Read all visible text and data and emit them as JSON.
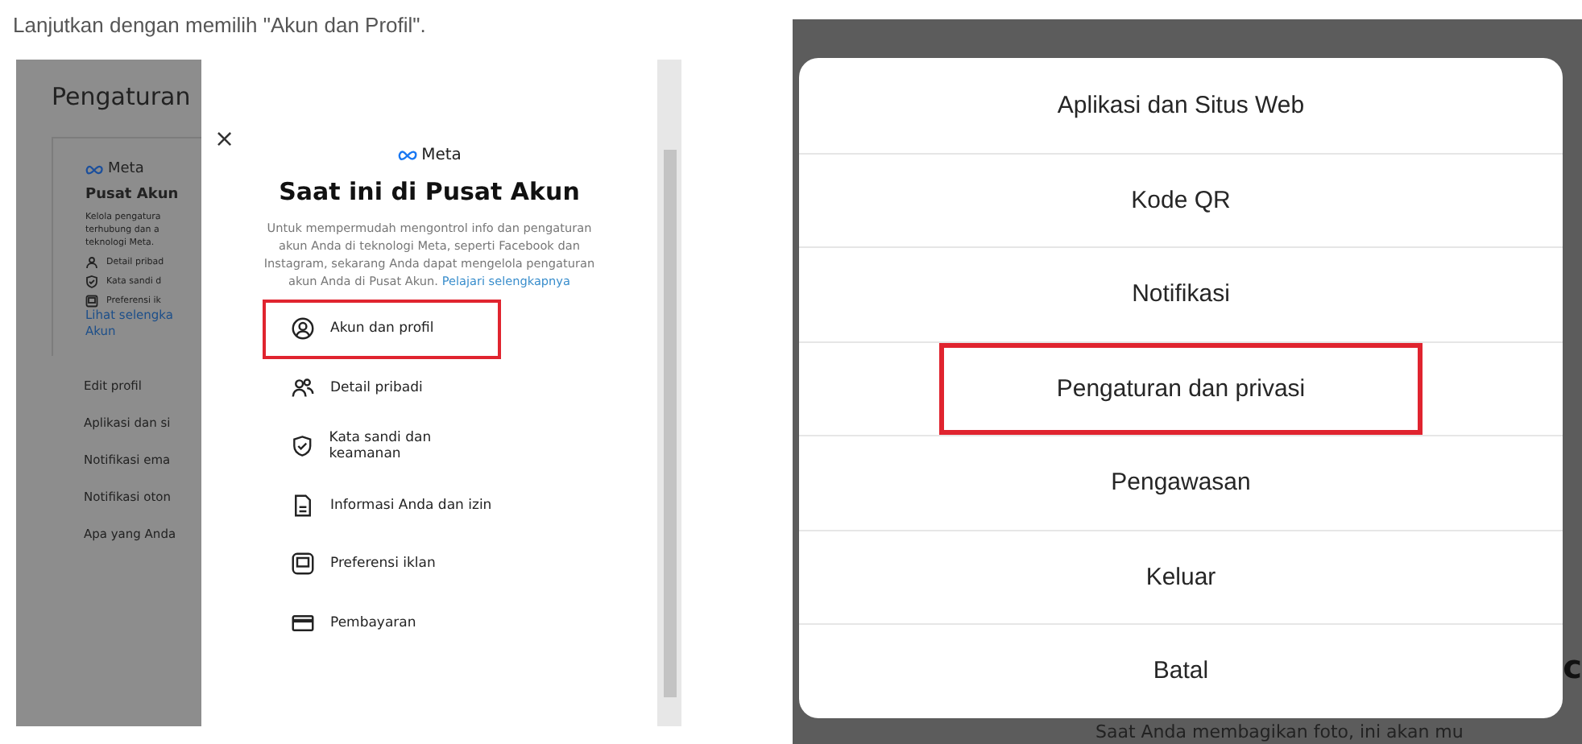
{
  "caption": "Lanjutkan dengan memilih \"Akun dan Profil\".",
  "left_screenshot": {
    "background_page": {
      "title": "Pengaturan",
      "logo": "Meta",
      "card_title": "Pusat Akun",
      "card_text": [
        "Kelola pengatura",
        "terhubung dan a",
        "teknologi Meta."
      ],
      "card_items": [
        {
          "kind": "person",
          "label": "Detail pribad"
        },
        {
          "kind": "shield",
          "label": "Kata sandi d"
        },
        {
          "kind": "ad",
          "label": "Preferensi ik"
        }
      ],
      "link": [
        "Lihat selengka",
        "Akun"
      ],
      "menu": [
        "Edit profil",
        "Aplikasi dan si",
        "Notifikasi ema",
        "Notifikasi oton",
        "Apa yang Anda"
      ]
    },
    "modal": {
      "close": "×",
      "logo": "Meta",
      "title": "Saat ini di Pusat Akun",
      "description": "Untuk mempermudah mengontrol info dan pengaturan akun Anda di teknologi Meta, seperti Facebook dan Instagram, sekarang Anda dapat mengelola pengaturan akun Anda di Pusat Akun.",
      "link": "Pelajari selengkapnya",
      "items": [
        {
          "kind": "account",
          "label": "Akun dan profil",
          "highlighted": true
        },
        {
          "kind": "people",
          "label": "Detail pribadi",
          "highlighted": false
        },
        {
          "kind": "shield",
          "label": "Kata sandi dan keamanan",
          "highlighted": false
        },
        {
          "kind": "document",
          "label": "Informasi Anda dan izin",
          "highlighted": false
        },
        {
          "kind": "ad",
          "label": "Preferensi iklan",
          "highlighted": false
        },
        {
          "kind": "card",
          "label": "Pembayaran",
          "highlighted": false
        }
      ]
    }
  },
  "right_screenshot": {
    "menu": [
      {
        "label": "Aplikasi dan Situs Web",
        "highlighted": false
      },
      {
        "label": "Kode QR",
        "highlighted": false
      },
      {
        "label": "Notifikasi",
        "highlighted": false
      },
      {
        "label": "Pengaturan dan privasi",
        "highlighted": true
      },
      {
        "label": "Pengawasan",
        "highlighted": false
      },
      {
        "label": "Keluar",
        "highlighted": false
      },
      {
        "label": "Batal",
        "highlighted": false
      }
    ],
    "side_letter": "c",
    "footer_text": "Saat Anda membagikan foto, ini akan mu"
  }
}
